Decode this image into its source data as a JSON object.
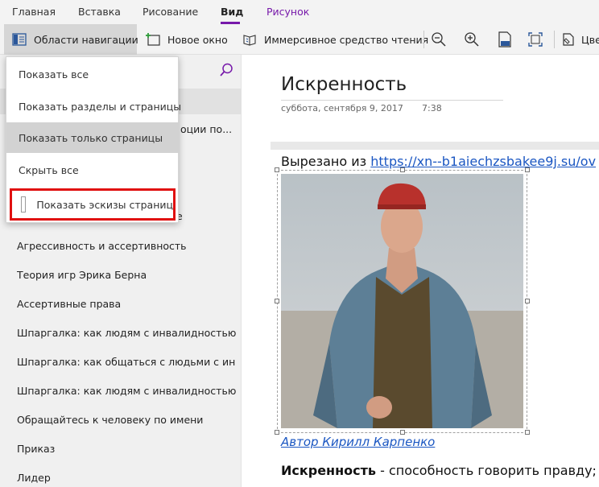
{
  "tabs": [
    "Главная",
    "Вставка",
    "Рисование",
    "Вид",
    "Рисунок"
  ],
  "toolbar": {
    "nav_panes": "Области навигации",
    "new_window": "Новое окно",
    "immersive_reader": "Иммерсивное средство чтения",
    "color_partial": "Цве"
  },
  "nav_menu": {
    "show_all": "Показать все",
    "show_sections_pages": "Показать разделы и страницы",
    "show_pages_only": "Показать только страницы",
    "hide_all": "Скрыть все",
    "show_thumbnails": "Показать эскизы страниц"
  },
  "nav_pane": {
    "partial_item_1": "оции по...",
    "partial_item_2": "е",
    "pages": [
      "Агрессивность и ассертивность",
      "Теория игр Эрика Берна",
      "Ассертивные права",
      "Шпаргалка: как людям с инвалидностью б...",
      "Шпаргалка: как общаться с людьми с инва...",
      "Шпаргалка: как людям с инвалидностью б...",
      "Обращайтесь к человеку по имени",
      "Приказ",
      "Лидер"
    ]
  },
  "page": {
    "title": "Искренность",
    "date": "суббота, сентября 9, 2017",
    "time": "7:38",
    "clipped_from_label": "Вырезано из ",
    "clipped_from_url": "https://xn--b1aiechzsbakee9j.su/ov",
    "author": "Автор Кирилл Карпенко",
    "body_bold": "Искренность",
    "body_text": " - способность говорить правду;"
  }
}
